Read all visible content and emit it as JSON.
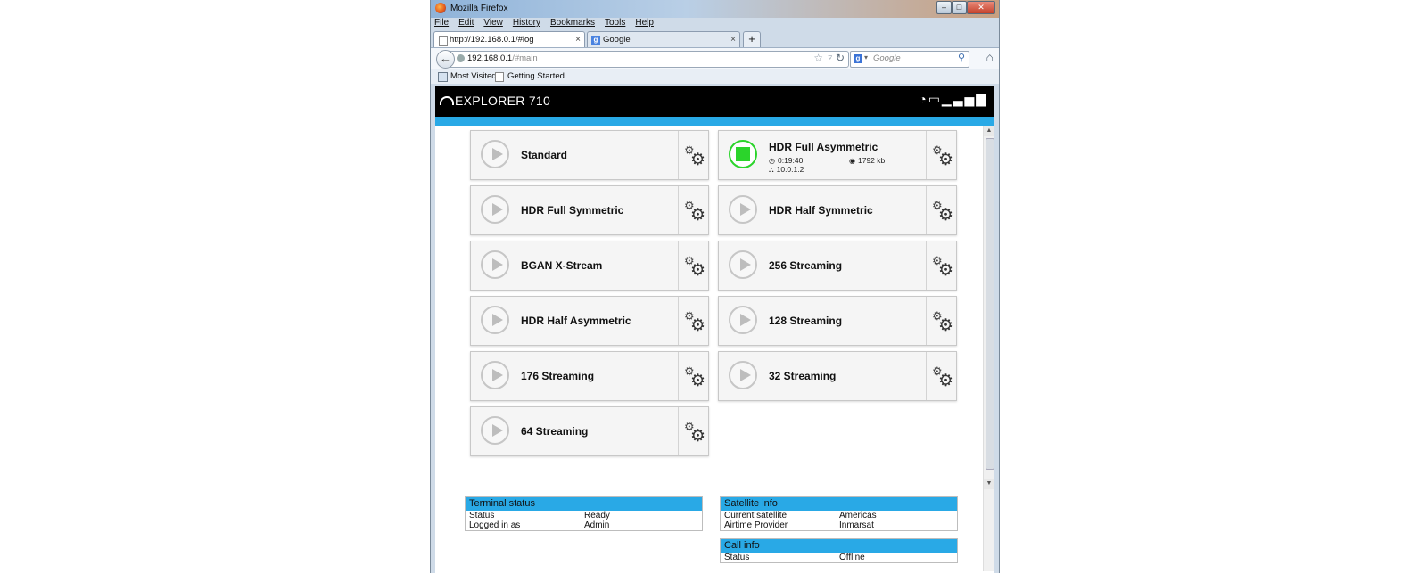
{
  "browser": {
    "window_title": "Mozilla Firefox",
    "window_controls": [
      "–",
      "□",
      "✕"
    ],
    "menu": [
      "File",
      "Edit",
      "View",
      "History",
      "Bookmarks",
      "Tools",
      "Help"
    ],
    "tabs": [
      {
        "label": "http://192.168.0.1/#log",
        "close": "×"
      },
      {
        "label": "Google",
        "close": "×"
      }
    ],
    "new_tab": "+",
    "back": "←",
    "url_host": "192.168.0.1",
    "url_path": "/#main",
    "search_placeholder": "Google",
    "bookmarks": [
      "Most Visited",
      "Getting Started"
    ]
  },
  "app": {
    "title": "EXPLORER 710",
    "status_icons": "wifi battery signal"
  },
  "profiles": [
    {
      "label": "Standard",
      "active": false
    },
    {
      "label": "HDR Full Asymmetric",
      "active": true,
      "duration": "0:19:40",
      "data": "1792 kb",
      "ip": "10.0.1.2"
    },
    {
      "label": "HDR Full Symmetric",
      "active": false
    },
    {
      "label": "HDR Half Symmetric",
      "active": false
    },
    {
      "label": "BGAN X-Stream",
      "active": false
    },
    {
      "label": "256 Streaming",
      "active": false
    },
    {
      "label": "HDR Half Asymmetric",
      "active": false
    },
    {
      "label": "128 Streaming",
      "active": false
    },
    {
      "label": "176 Streaming",
      "active": false
    },
    {
      "label": "32 Streaming",
      "active": false
    },
    {
      "label": "64 Streaming",
      "active": false
    }
  ],
  "terminal_status": {
    "title": "Terminal status",
    "rows": [
      {
        "key": "Status",
        "value": "Ready"
      },
      {
        "key": "Logged in as",
        "value": "Admin"
      }
    ]
  },
  "satellite_info": {
    "title": "Satellite info",
    "rows": [
      {
        "key": "Current satellite",
        "value": "Americas"
      },
      {
        "key": "Airtime Provider",
        "value": "Inmarsat"
      }
    ]
  },
  "call_info": {
    "title": "Call info",
    "rows": [
      {
        "key": "Status",
        "value": "Offline"
      }
    ]
  },
  "colors": {
    "accent_blue": "#29a9e6",
    "active_green": "#2bd42b",
    "header_black": "#000000"
  }
}
